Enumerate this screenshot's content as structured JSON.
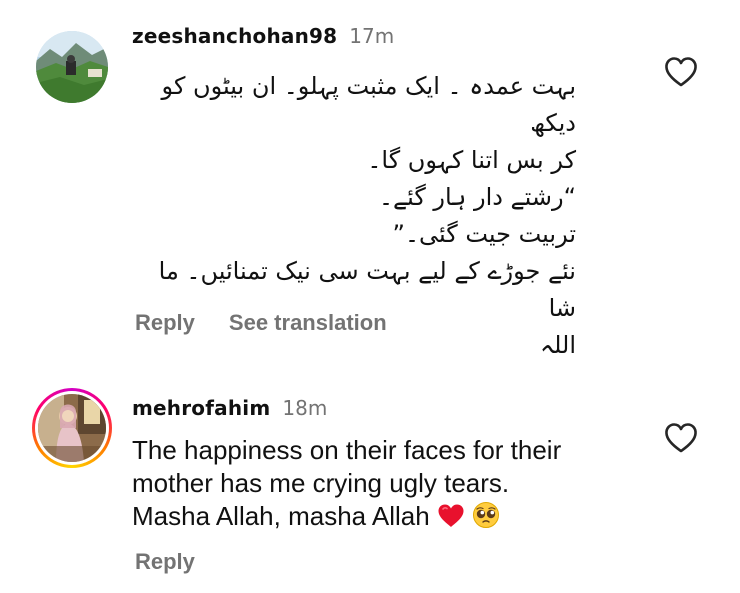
{
  "comments": [
    {
      "username": "zeeshanchohan98",
      "time": "17m",
      "text_lines": [
        "بہت عمدہ ۔ ایک مثبت پہلو۔ ان بیٹوں کو دیکھ",
        "کر بس اتنا کہوں گا۔",
        "“رشتے دار ہار گئے۔",
        "تربیت جیت گئی۔”",
        "نئے جوڑے کے لیے بہت سی نیک تمنائیں۔ ما شا",
        "اللہ"
      ],
      "reply_label": "Reply",
      "translate_label": "See translation",
      "avatar_icon": "landscape-avatar"
    },
    {
      "username": "mehrofahim",
      "time": "18m",
      "text_lines": [
        "The happiness on their faces for their",
        "mother has me crying ugly tears.",
        "Masha Allah, masha Allah"
      ],
      "emojis": [
        "red-heart-icon",
        "pleading-face-icon"
      ],
      "reply_label": "Reply",
      "avatar_icon": "portrait-avatar-with-story-ring"
    }
  ],
  "colors": {
    "text": "#111111",
    "secondary": "#737373",
    "heart_red": "#e8112d",
    "story_ring": [
      "#d300c5",
      "#ff0069",
      "#ffd600"
    ]
  }
}
